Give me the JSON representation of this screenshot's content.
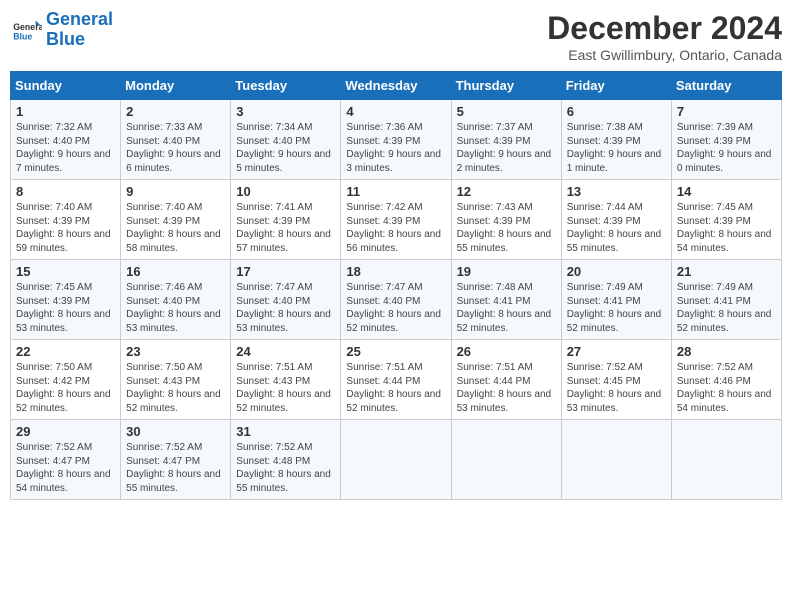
{
  "logo": {
    "line1": "General",
    "line2": "Blue"
  },
  "title": "December 2024",
  "location": "East Gwillimbury, Ontario, Canada",
  "days_of_week": [
    "Sunday",
    "Monday",
    "Tuesday",
    "Wednesday",
    "Thursday",
    "Friday",
    "Saturday"
  ],
  "weeks": [
    [
      {
        "day": "1",
        "sunrise": "7:32 AM",
        "sunset": "4:40 PM",
        "daylight": "9 hours and 7 minutes."
      },
      {
        "day": "2",
        "sunrise": "7:33 AM",
        "sunset": "4:40 PM",
        "daylight": "9 hours and 6 minutes."
      },
      {
        "day": "3",
        "sunrise": "7:34 AM",
        "sunset": "4:40 PM",
        "daylight": "9 hours and 5 minutes."
      },
      {
        "day": "4",
        "sunrise": "7:36 AM",
        "sunset": "4:39 PM",
        "daylight": "9 hours and 3 minutes."
      },
      {
        "day": "5",
        "sunrise": "7:37 AM",
        "sunset": "4:39 PM",
        "daylight": "9 hours and 2 minutes."
      },
      {
        "day": "6",
        "sunrise": "7:38 AM",
        "sunset": "4:39 PM",
        "daylight": "9 hours and 1 minute."
      },
      {
        "day": "7",
        "sunrise": "7:39 AM",
        "sunset": "4:39 PM",
        "daylight": "9 hours and 0 minutes."
      }
    ],
    [
      {
        "day": "8",
        "sunrise": "7:40 AM",
        "sunset": "4:39 PM",
        "daylight": "8 hours and 59 minutes."
      },
      {
        "day": "9",
        "sunrise": "7:40 AM",
        "sunset": "4:39 PM",
        "daylight": "8 hours and 58 minutes."
      },
      {
        "day": "10",
        "sunrise": "7:41 AM",
        "sunset": "4:39 PM",
        "daylight": "8 hours and 57 minutes."
      },
      {
        "day": "11",
        "sunrise": "7:42 AM",
        "sunset": "4:39 PM",
        "daylight": "8 hours and 56 minutes."
      },
      {
        "day": "12",
        "sunrise": "7:43 AM",
        "sunset": "4:39 PM",
        "daylight": "8 hours and 55 minutes."
      },
      {
        "day": "13",
        "sunrise": "7:44 AM",
        "sunset": "4:39 PM",
        "daylight": "8 hours and 55 minutes."
      },
      {
        "day": "14",
        "sunrise": "7:45 AM",
        "sunset": "4:39 PM",
        "daylight": "8 hours and 54 minutes."
      }
    ],
    [
      {
        "day": "15",
        "sunrise": "7:45 AM",
        "sunset": "4:39 PM",
        "daylight": "8 hours and 53 minutes."
      },
      {
        "day": "16",
        "sunrise": "7:46 AM",
        "sunset": "4:40 PM",
        "daylight": "8 hours and 53 minutes."
      },
      {
        "day": "17",
        "sunrise": "7:47 AM",
        "sunset": "4:40 PM",
        "daylight": "8 hours and 53 minutes."
      },
      {
        "day": "18",
        "sunrise": "7:47 AM",
        "sunset": "4:40 PM",
        "daylight": "8 hours and 52 minutes."
      },
      {
        "day": "19",
        "sunrise": "7:48 AM",
        "sunset": "4:41 PM",
        "daylight": "8 hours and 52 minutes."
      },
      {
        "day": "20",
        "sunrise": "7:49 AM",
        "sunset": "4:41 PM",
        "daylight": "8 hours and 52 minutes."
      },
      {
        "day": "21",
        "sunrise": "7:49 AM",
        "sunset": "4:41 PM",
        "daylight": "8 hours and 52 minutes."
      }
    ],
    [
      {
        "day": "22",
        "sunrise": "7:50 AM",
        "sunset": "4:42 PM",
        "daylight": "8 hours and 52 minutes."
      },
      {
        "day": "23",
        "sunrise": "7:50 AM",
        "sunset": "4:43 PM",
        "daylight": "8 hours and 52 minutes."
      },
      {
        "day": "24",
        "sunrise": "7:51 AM",
        "sunset": "4:43 PM",
        "daylight": "8 hours and 52 minutes."
      },
      {
        "day": "25",
        "sunrise": "7:51 AM",
        "sunset": "4:44 PM",
        "daylight": "8 hours and 52 minutes."
      },
      {
        "day": "26",
        "sunrise": "7:51 AM",
        "sunset": "4:44 PM",
        "daylight": "8 hours and 53 minutes."
      },
      {
        "day": "27",
        "sunrise": "7:52 AM",
        "sunset": "4:45 PM",
        "daylight": "8 hours and 53 minutes."
      },
      {
        "day": "28",
        "sunrise": "7:52 AM",
        "sunset": "4:46 PM",
        "daylight": "8 hours and 54 minutes."
      }
    ],
    [
      {
        "day": "29",
        "sunrise": "7:52 AM",
        "sunset": "4:47 PM",
        "daylight": "8 hours and 54 minutes."
      },
      {
        "day": "30",
        "sunrise": "7:52 AM",
        "sunset": "4:47 PM",
        "daylight": "8 hours and 55 minutes."
      },
      {
        "day": "31",
        "sunrise": "7:52 AM",
        "sunset": "4:48 PM",
        "daylight": "8 hours and 55 minutes."
      },
      null,
      null,
      null,
      null
    ]
  ]
}
